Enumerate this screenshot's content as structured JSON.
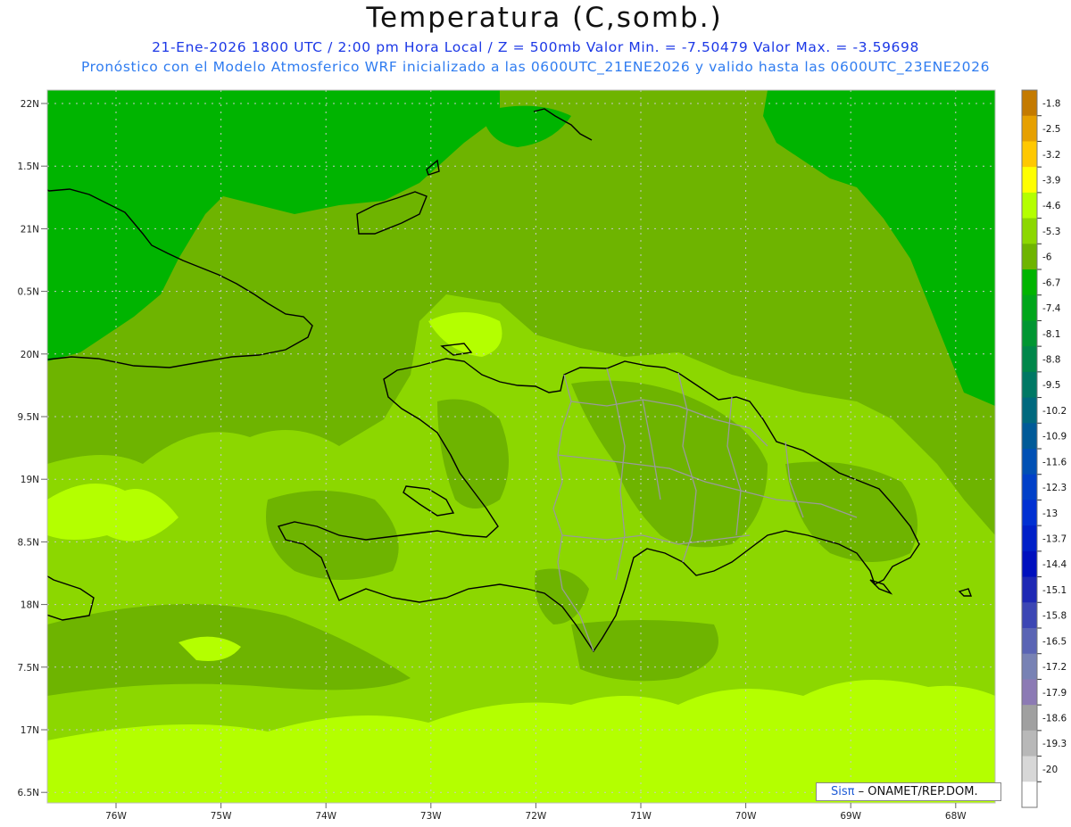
{
  "title": "Temperatura (C,somb.)",
  "subtitle_line1": "21-Ene-2026  1800 UTC / 2:00 pm Hora Local / Z = 500mb  Valor Min. = -7.50479  Valor Max. = -3.59698",
  "subtitle_line2": "Pronóstico con el Modelo Atmosferico WRF inicializado a las 0600UTC_21ENE2026 y valido hasta las  0600UTC_23ENE2026",
  "attribution": {
    "brand": "Sisπ",
    "text": " – ONAMET/REP.DOM."
  },
  "latitude_labels": [
    "22N",
    "1.5N",
    "21N",
    "0.5N",
    "20N",
    "9.5N",
    "19N",
    "8.5N",
    "18N",
    "7.5N",
    "17N",
    "6.5N"
  ],
  "longitude_labels": [
    "76W",
    "75W",
    "74W",
    "73W",
    "72W",
    "71W",
    "70W",
    "69W",
    "68W"
  ],
  "colorbar": {
    "levels": [
      {
        "label": "-1.8",
        "color": "#c47a00"
      },
      {
        "label": "-2.5",
        "color": "#e6a000"
      },
      {
        "label": "-3.2",
        "color": "#ffc800"
      },
      {
        "label": "-3.9",
        "color": "#ffff00"
      },
      {
        "label": "-4.6",
        "color": "#b4ff00"
      },
      {
        "label": "-5.3",
        "color": "#8cd700"
      },
      {
        "label": "-6",
        "color": "#6eb400"
      },
      {
        "label": "-6.7",
        "color": "#00b400"
      },
      {
        "label": "-7.4",
        "color": "#00a61a"
      },
      {
        "label": "-8.1",
        "color": "#009632"
      },
      {
        "label": "-8.8",
        "color": "#00874a"
      },
      {
        "label": "-9.5",
        "color": "#007864"
      },
      {
        "label": "-10.2",
        "color": "#00697e"
      },
      {
        "label": "-10.9",
        "color": "#005a98"
      },
      {
        "label": "-11.6",
        "color": "#0050b4"
      },
      {
        "label": "-12.3",
        "color": "#0040c8"
      },
      {
        "label": "-13",
        "color": "#0030d2"
      },
      {
        "label": "-13.7",
        "color": "#0020c8"
      },
      {
        "label": "-14.4",
        "color": "#0010be"
      },
      {
        "label": "-15.1",
        "color": "#1e28b4"
      },
      {
        "label": "-15.8",
        "color": "#3c46b4"
      },
      {
        "label": "-16.5",
        "color": "#5a64b4"
      },
      {
        "label": "-17.2",
        "color": "#7882b4"
      },
      {
        "label": "-17.9",
        "color": "#8c7ab4"
      },
      {
        "label": "-18.6",
        "color": "#a0a0a0"
      },
      {
        "label": "-19.3",
        "color": "#b8b8b8"
      },
      {
        "label": "-20",
        "color": "#d7d7d7"
      },
      {
        "label": "",
        "color": "#ffffff"
      }
    ]
  },
  "field_colors": {
    "dark_green": "#00b400",
    "green": "#6eb400",
    "light_green": "#8cd700",
    "yellow_green": "#b4ff00",
    "coastline": "#000000",
    "province_border": "#9a9a9a",
    "grid": "#c8c8c8"
  }
}
